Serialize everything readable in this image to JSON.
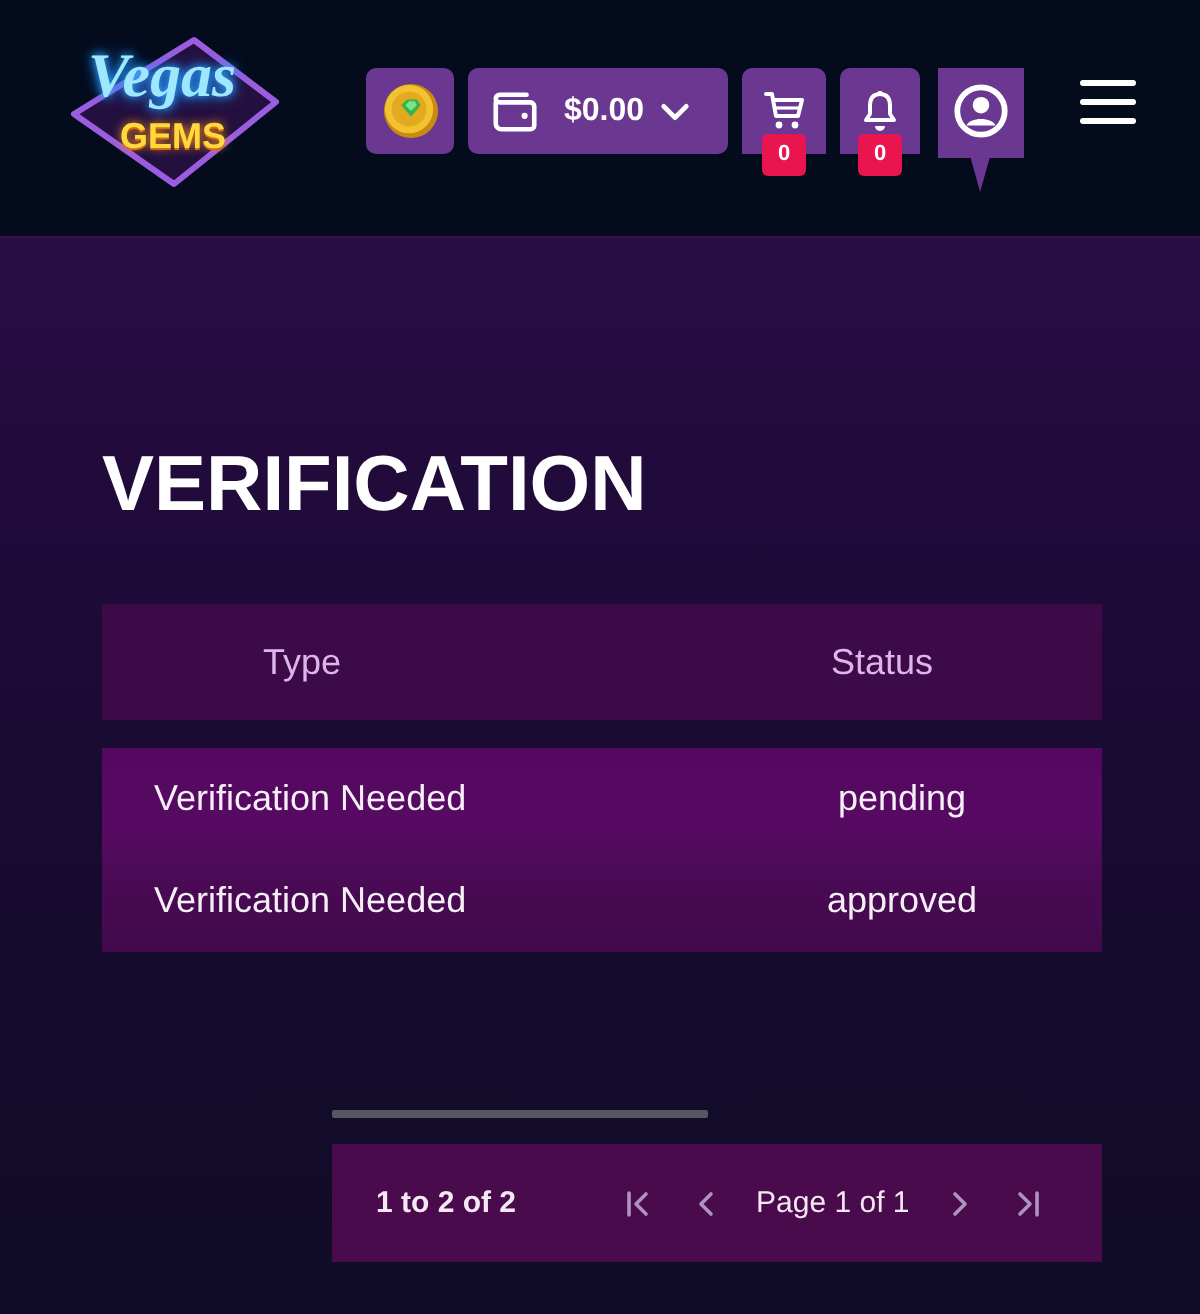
{
  "header": {
    "logo": {
      "script": "Vegas",
      "wordmark": "GEMS"
    },
    "wallet": {
      "balance": "$0.00"
    },
    "cart": {
      "count": "0"
    },
    "notifications": {
      "count": "0"
    }
  },
  "page": {
    "title": "VERIFICATION"
  },
  "table": {
    "columns": [
      "Type",
      "Status"
    ],
    "rows": [
      {
        "type": "Verification Needed",
        "status": "pending"
      },
      {
        "type": "Verification Needed",
        "status": "approved"
      }
    ]
  },
  "pagination": {
    "summary": "1 to 2 of 2",
    "page_label": "Page 1 of 1",
    "controls": [
      {
        "kind": "first",
        "disabled": true
      },
      {
        "kind": "previous",
        "disabled": true
      },
      {
        "kind": "next",
        "disabled": true
      },
      {
        "kind": "last",
        "disabled": true
      }
    ]
  }
}
